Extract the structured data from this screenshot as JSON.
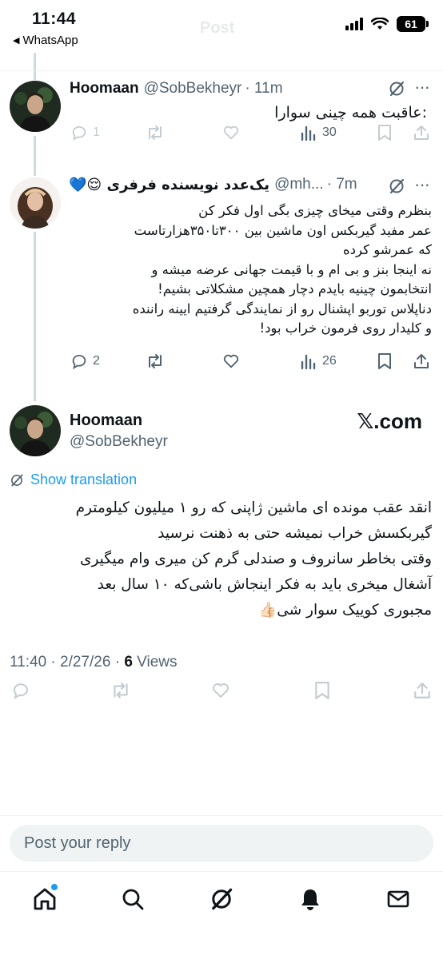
{
  "status_bar": {
    "time": "11:44",
    "back_app": "WhatsApp",
    "battery": "61",
    "ghost_title": "Post"
  },
  "tweets": [
    {
      "name": "Hoomaan",
      "handle": "@SobBekheyr",
      "time": "· 11m",
      "text": ":عاقبت همه چینی سوارا",
      "replies": "1",
      "views": "30"
    },
    {
      "name": "یک‌عدد نویسنده فرفری 😌💙",
      "handle": "@mh...",
      "time": "· 7m",
      "text_lines": [
        "بنظرم وقتی میخای چیزی بگی اول فکر کن",
        "عمر مفید گیربکس اون ماشین بین ۳۰۰تا۳۵۰هزارتاست",
        "که عمرشو کرده",
        "نه اینجا بنز و بی ام و با قیمت جهانی عرضه میشه و",
        "انتخابمون چینیه بایدم دچار همچین مشکلاتی بشیم!",
        "دناپلاس توربو اپشنال رو از نمایندگی گرفتیم ایینه راننده",
        "و کلیدار روی فرمون خراب بود!"
      ],
      "replies": "2",
      "views": "26"
    }
  ],
  "main_tweet": {
    "name": "Hoomaan",
    "handle": "@SobBekheyr",
    "watermark": "𝕏.com",
    "show_translation": "Show translation",
    "text_lines": [
      "انقد عقب مونده ای ماشین ژاپنی که رو ۱ میلیون کیلومترم",
      "گیربکسش خراب نمیشه حتی به ذهنت نرسید",
      "وقتی بخاطر سانروف و صندلی گرم کن میری وام میگیری",
      "آشغال میخری باید به فکر اینجاش باشی‌که ۱۰ سال بعد",
      "مجبوری کوییک سوار شی👍🏻"
    ],
    "timestamp": "11:40 · 2/27/26 · ",
    "views_count": "6",
    "views_label": " Views"
  },
  "reply_placeholder": "Post your reply",
  "colors": {
    "accent": "#1d9bf0",
    "muted": "#536471",
    "thread": "#cfd9de"
  }
}
